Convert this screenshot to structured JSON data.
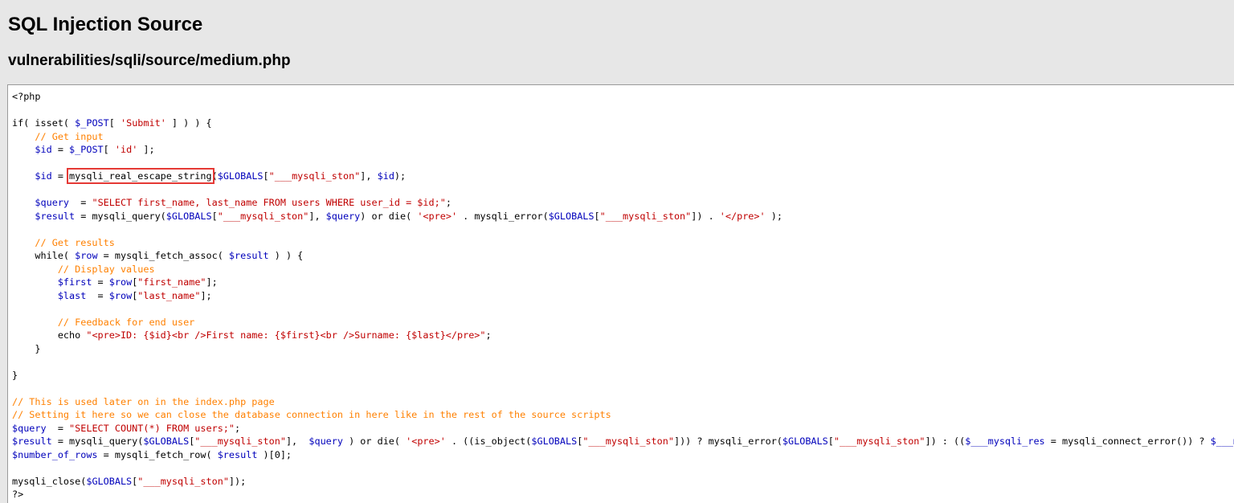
{
  "page": {
    "title": "SQL Injection Source",
    "file_path": "vulnerabilities/sqli/source/medium.php"
  },
  "code": {
    "highlighted_function": "mysqli_real_escape_string",
    "highlight_color": "#e53935",
    "lines": [
      "<?php",
      "",
      "if( isset( $_POST[ 'Submit' ] ) ) {",
      "    // Get input",
      "    $id = $_POST[ 'id' ];",
      "",
      "    $id = mysqli_real_escape_string($GLOBALS[\"___mysqli_ston\"], $id);",
      "",
      "    $query  = \"SELECT first_name, last_name FROM users WHERE user_id = $id;\";",
      "    $result = mysqli_query($GLOBALS[\"___mysqli_ston\"], $query) or die( '<pre>' . mysqli_error($GLOBALS[\"___mysqli_ston\"]) . '</pre>' );",
      "",
      "    // Get results",
      "    while( $row = mysqli_fetch_assoc( $result ) ) {",
      "        // Display values",
      "        $first = $row[\"first_name\"];",
      "        $last  = $row[\"last_name\"];",
      "",
      "        // Feedback for end user",
      "        echo \"<pre>ID: {$id}<br />First name: {$first}<br />Surname: {$last}</pre>\";",
      "    }",
      "",
      "}",
      "",
      "// This is used later on in the index.php page",
      "// Setting it here so we can close the database connection in here like in the rest of the source scripts",
      "$query  = \"SELECT COUNT(*) FROM users;\";",
      "$result = mysqli_query($GLOBALS[\"___mysqli_ston\"],  $query ) or die( '<pre>' . ((is_object($GLOBALS[\"___mysqli_ston\"])) ? mysqli_error($GLOBALS[\"___mysqli_ston\"]) : (($___mysqli_res = mysqli_connect_error()) ? $___mysqli_res : false)) . '</pre>' );",
      "$number_of_rows = mysqli_fetch_row( $result )[0];",
      "",
      "mysqli_close($GLOBALS[\"___mysqli_ston\"]);",
      "?>"
    ]
  },
  "colors": {
    "background": "#e7e7e7",
    "code_background": "#ffffff",
    "keyword": "#000000",
    "string": "#c00000",
    "comment": "#ff8000",
    "variable": "#0000bb"
  }
}
